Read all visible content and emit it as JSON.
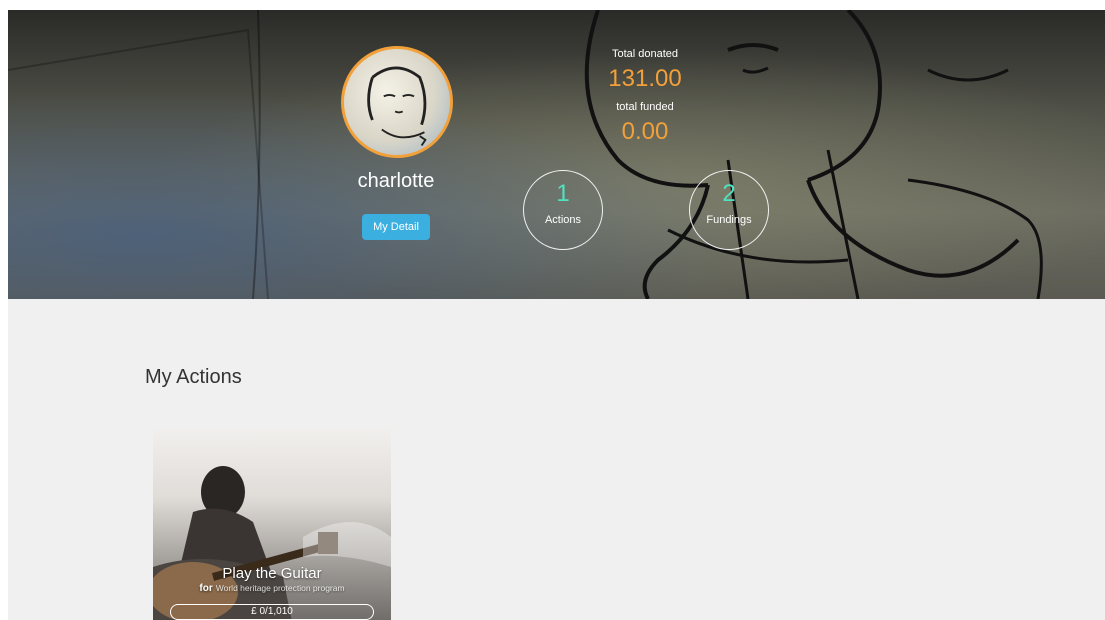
{
  "profile": {
    "username": "charlotte",
    "detail_button": "My Detail"
  },
  "stats": {
    "total_donated_label": "Total donated",
    "total_donated_value": "131.00",
    "total_funded_label": "total funded",
    "total_funded_value": "0.00",
    "actions_count": "1",
    "actions_label": "Actions",
    "fundings_count": "2",
    "fundings_label": "Fundings"
  },
  "section": {
    "title": "My Actions"
  },
  "action_card": {
    "title": "Play the Guitar",
    "for_label": "for",
    "organization": "World heritage protection program",
    "progress_text": "£ 0/1,010",
    "progress_fraction": 0
  },
  "colors": {
    "accent_orange": "#f2a03a",
    "accent_teal": "#4fe3c0",
    "button_blue": "#3bb0e0",
    "background": "#f0f0f0"
  }
}
